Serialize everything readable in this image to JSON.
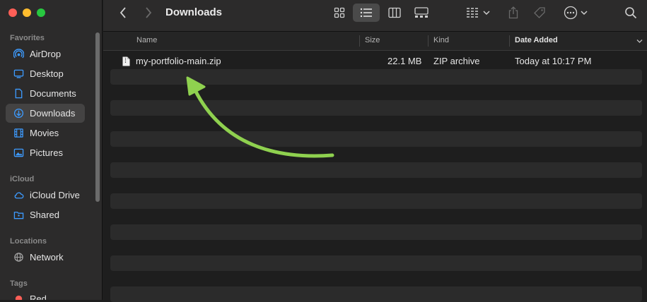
{
  "window": {
    "title": "Downloads"
  },
  "sidebar": {
    "sections": {
      "favorites": "Favorites",
      "icloud": "iCloud",
      "locations": "Locations",
      "tags": "Tags"
    },
    "favorites": [
      {
        "label": "AirDrop",
        "icon": "airdrop-icon"
      },
      {
        "label": "Desktop",
        "icon": "desktop-icon"
      },
      {
        "label": "Documents",
        "icon": "document-icon"
      },
      {
        "label": "Downloads",
        "icon": "download-icon",
        "selected": true
      },
      {
        "label": "Movies",
        "icon": "film-icon"
      },
      {
        "label": "Pictures",
        "icon": "photo-icon"
      }
    ],
    "icloud": [
      {
        "label": "iCloud Drive",
        "icon": "cloud-icon"
      },
      {
        "label": "Shared",
        "icon": "shared-folder-icon"
      }
    ],
    "locations": [
      {
        "label": "Network",
        "icon": "globe-icon"
      }
    ],
    "tags": [
      {
        "label": "Red",
        "color": "#ff5f57"
      }
    ]
  },
  "table": {
    "columns": {
      "name": "Name",
      "size": "Size",
      "kind": "Kind",
      "date_added": "Date Added"
    },
    "sorted_by": "date_added",
    "rows": [
      {
        "name": "my-portfolio-main.zip",
        "size": "22.1 MB",
        "kind": "ZIP archive",
        "date_added": "Today at 10:17 PM"
      }
    ]
  },
  "annotation": {
    "arrow_color": "#8fd14f"
  },
  "colors": {
    "accent": "#0a84ff"
  }
}
